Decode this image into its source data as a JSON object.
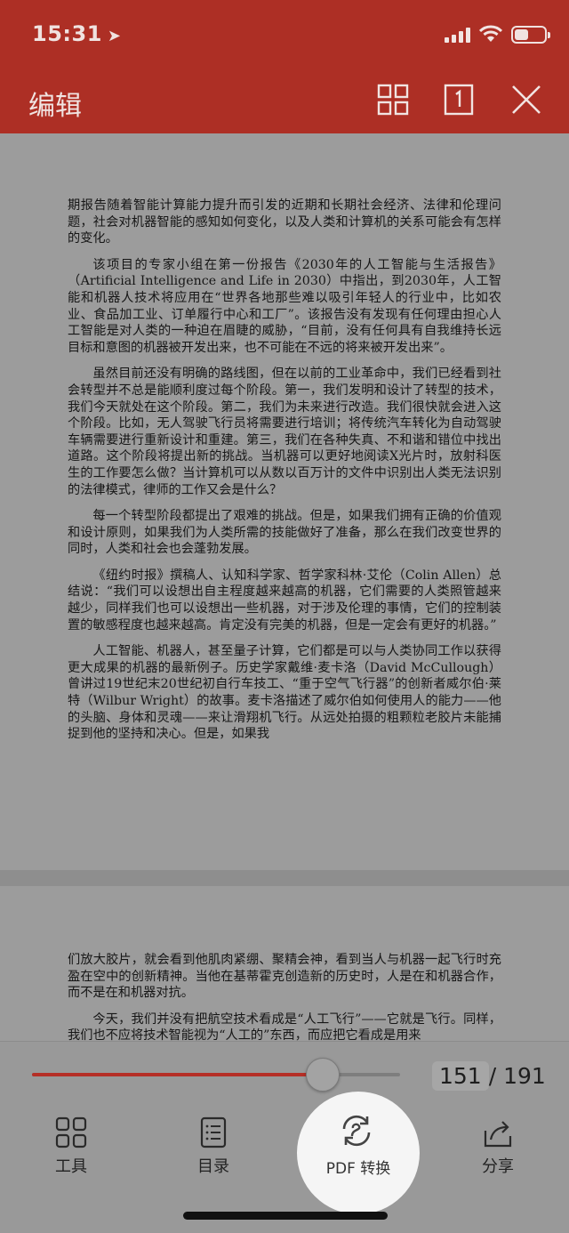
{
  "status_bar": {
    "time": "15:31"
  },
  "header": {
    "title": "编辑"
  },
  "document": {
    "page1": [
      "期报告随着智能计算能力提升而引发的近期和长期社会经济、法律和伦理问题，社会对机器智能的感知如何变化，以及人类和计算机的关系可能会有怎样的变化。",
      "该项目的专家小组在第一份报告《2030年的人工智能与生活报告》（Artificial Intelligence and Life in 2030）中指出，到2030年，人工智能和机器人技术将应用在“世界各地那些难以吸引年轻人的行业中，比如农业、食品加工业、订单履行中心和工厂”。该报告没有发现有任何理由担心人工智能是对人类的一种迫在眉睫的威胁，“目前，没有任何具有自我维持长远目标和意图的机器被开发出来，也不可能在不远的将来被开发出来”。",
      "虽然目前还没有明确的路线图，但在以前的工业革命中，我们已经看到社会转型并不总是能顺利度过每个阶段。第一，我们发明和设计了转型的技术，我们今天就处在这个阶段。第二，我们为未来进行改造。我们很快就会进入这个阶段。比如，无人驾驶飞行员将需要进行培训；将传统汽车转化为自动驾驶车辆需要进行重新设计和重建。第三，我们在各种失真、不和谐和错位中找出道路。这个阶段将提出新的挑战。当机器可以更好地阅读X光片时，放射科医生的工作要怎么做？当计算机可以从数以百万计的文件中识别出人类无法识别的法律模式，律师的工作又会是什么？",
      "每一个转型阶段都提出了艰难的挑战。但是，如果我们拥有正确的价值观和设计原则，如果我们为人类所需的技能做好了准备，那么在我们改变世界的同时，人类和社会也会蓬勃发展。",
      "《纽约时报》撰稿人、认知科学家、哲学家科林·艾伦（Colin Allen）总结说：“我们可以设想出自主程度越来越高的机器，它们需要的人类照管越来越少，同样我们也可以设想出一些机器，对于涉及伦理的事情，它们的控制装置的敏感程度也越来越高。肯定没有完美的机器，但是一定会有更好的机器。”",
      "人工智能、机器人，甚至量子计算，它们都是可以与人类协同工作以获得更大成果的机器的最新例子。历史学家戴维·麦卡洛（David McCullough）曾讲过19世纪末20世纪初自行车技工、“重于空气飞行器”的创新者威尔伯·莱特（Wilbur Wright）的故事。麦卡洛描述了威尔伯如何使用人的能力——他的头脑、身体和灵魂——来让滑翔机飞行。从远处拍摄的粗颗粒老胶片未能捕捉到他的坚持和决心。但是，如果我"
    ],
    "page2": [
      "们放大胶片，就会看到他肌肉紧绷、聚精会神，看到当人与机器一起飞行时充盈在空中的创新精神。当他在基蒂霍克创造新的历史时，人是在和机器合作，而不是在和机器对抗。",
      "今天，我们并没有把航空技术看成是“人工飞行”——它就是飞行。同样，我们也不应将技术智能视为“人工的”东西，而应把它看成是用来"
    ]
  },
  "reader": {
    "current_page": "151",
    "total_pages": "/ 191",
    "progress": 0.79
  },
  "toolbar": {
    "tools_label": "工具",
    "toc_label": "目录",
    "pdf_label": "PDF 转换",
    "share_label": "分享"
  },
  "colors": {
    "accent": "#ad2f25",
    "progress_fill": "#b52f26"
  }
}
